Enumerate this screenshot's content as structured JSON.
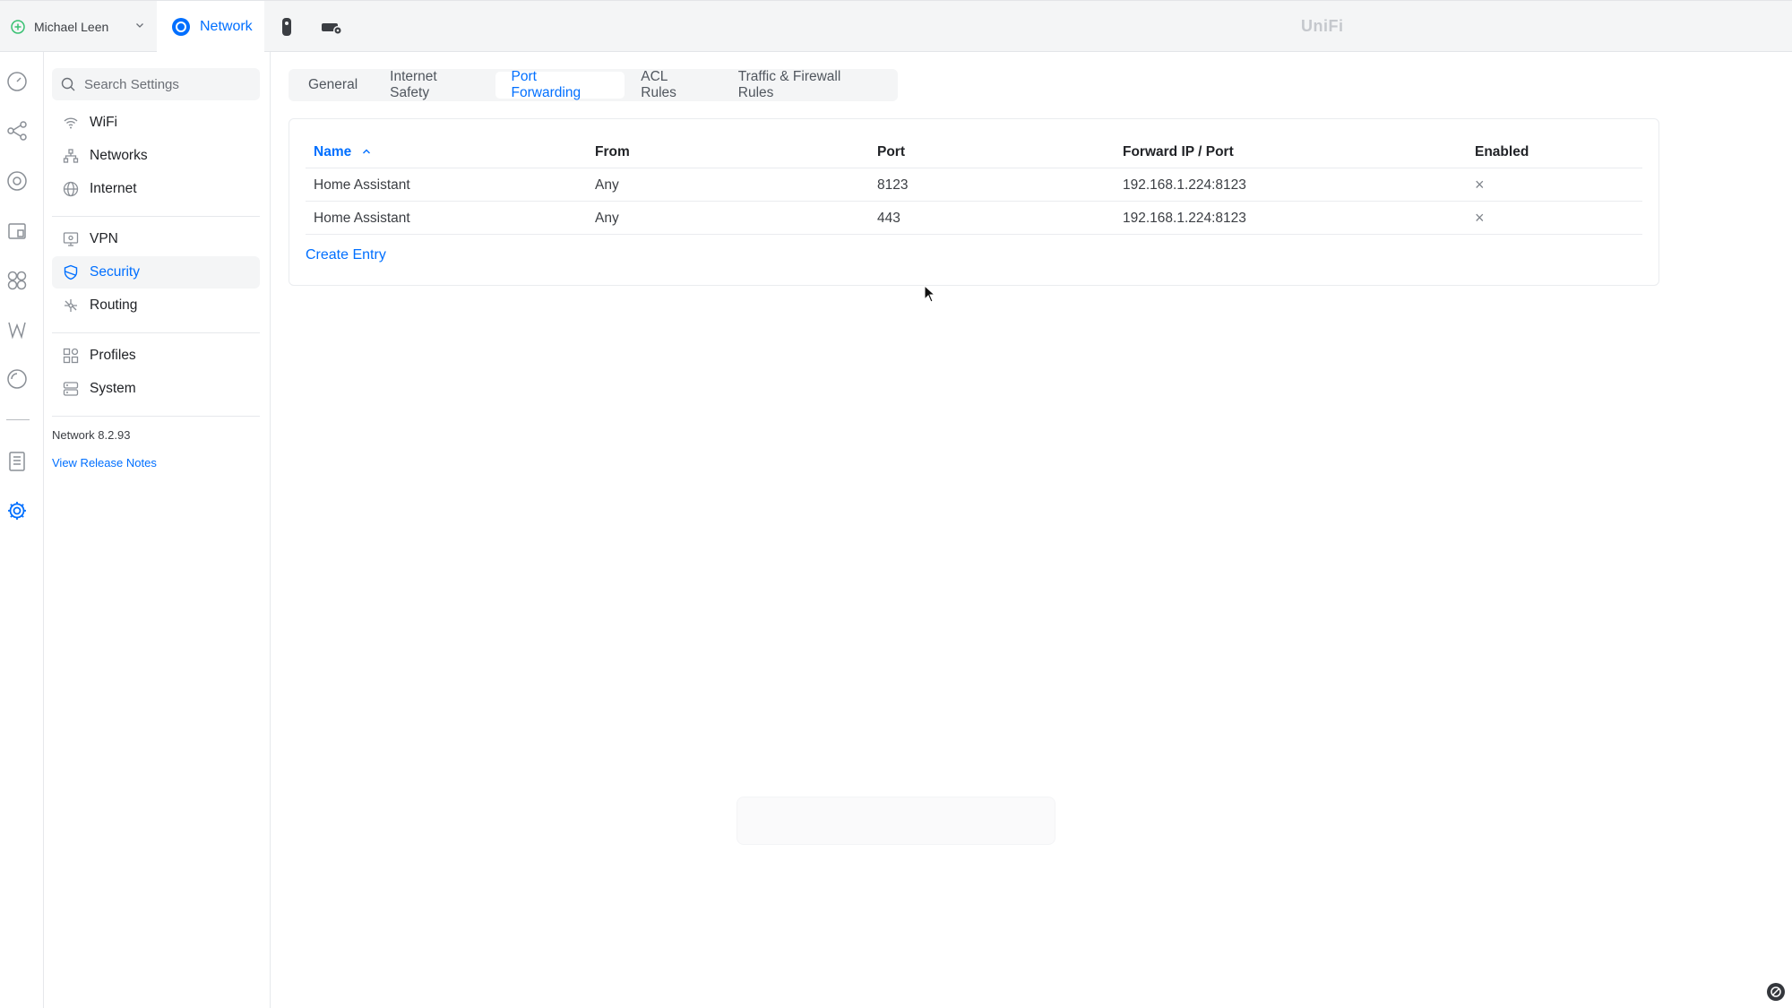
{
  "topbar": {
    "user_name": "Michael Leen",
    "app_tab_label": "Network",
    "brand": "UniFi"
  },
  "sidebar": {
    "search_placeholder": "Search Settings",
    "items": [
      {
        "label": "WiFi",
        "icon": "wifi-icon"
      },
      {
        "label": "Networks",
        "icon": "networks-icon"
      },
      {
        "label": "Internet",
        "icon": "globe-icon"
      },
      {
        "label": "VPN",
        "icon": "vpn-icon"
      },
      {
        "label": "Security",
        "icon": "shield-icon",
        "active": true
      },
      {
        "label": "Routing",
        "icon": "routing-icon"
      },
      {
        "label": "Profiles",
        "icon": "profiles-icon"
      },
      {
        "label": "System",
        "icon": "system-icon"
      }
    ],
    "version": "Network 8.2.93",
    "release_notes": "View Release Notes"
  },
  "tabs": [
    {
      "label": "General"
    },
    {
      "label": "Internet Safety"
    },
    {
      "label": "Port Forwarding",
      "active": true
    },
    {
      "label": "ACL Rules"
    },
    {
      "label": "Traffic & Firewall Rules"
    }
  ],
  "table": {
    "headers": [
      "Name",
      "From",
      "Port",
      "Forward IP / Port",
      "Enabled"
    ],
    "rows": [
      {
        "name": "Home Assistant",
        "from": "Any",
        "port": "8123",
        "forward": "192.168.1.224:8123",
        "enabled": "×"
      },
      {
        "name": "Home Assistant",
        "from": "Any",
        "port": "443",
        "forward": "192.168.1.224:8123",
        "enabled": "×"
      }
    ],
    "create_label": "Create Entry"
  },
  "colors": {
    "accent": "#006fff",
    "active_bg": "#f4f5f6",
    "text": "#212327"
  }
}
